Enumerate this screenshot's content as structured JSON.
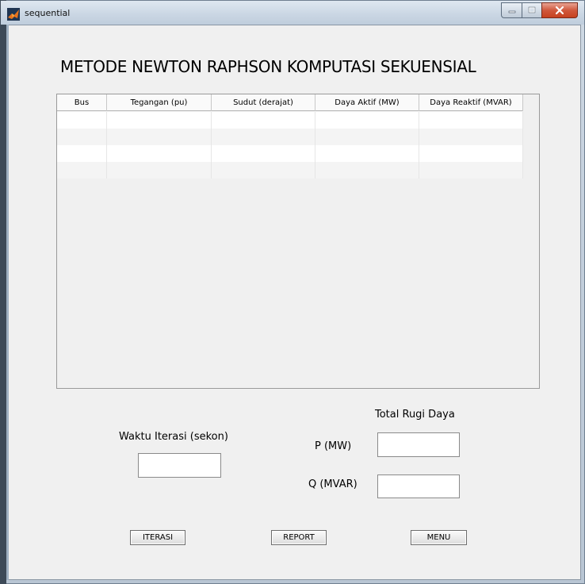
{
  "window": {
    "title": "sequential",
    "controls": [
      "minimize-icon",
      "maximize-icon",
      "close-icon"
    ],
    "close_button_color": "#c7411f"
  },
  "page": {
    "heading": "METODE NEWTON RAPHSON KOMPUTASI SEKUENSIAL"
  },
  "table": {
    "columns": [
      "Bus",
      "Tegangan (pu)",
      "Sudut (derajat)",
      "Daya Aktif (MW)",
      "Daya Reaktif (MVAR)"
    ],
    "rows": [
      [
        "",
        "",
        "",
        "",
        ""
      ],
      [
        "",
        "",
        "",
        "",
        ""
      ],
      [
        "",
        "",
        "",
        "",
        ""
      ],
      [
        "",
        "",
        "",
        "",
        ""
      ]
    ]
  },
  "waktu": {
    "label": "Waktu Iterasi (sekon)",
    "value": ""
  },
  "rugi": {
    "title": "Total Rugi Daya",
    "p_label": "P (MW)",
    "p_value": "",
    "q_label": "Q (MVAR)",
    "q_value": ""
  },
  "buttons": {
    "iterasi": "ITERASI",
    "report": "REPORT",
    "menu": "MENU"
  }
}
